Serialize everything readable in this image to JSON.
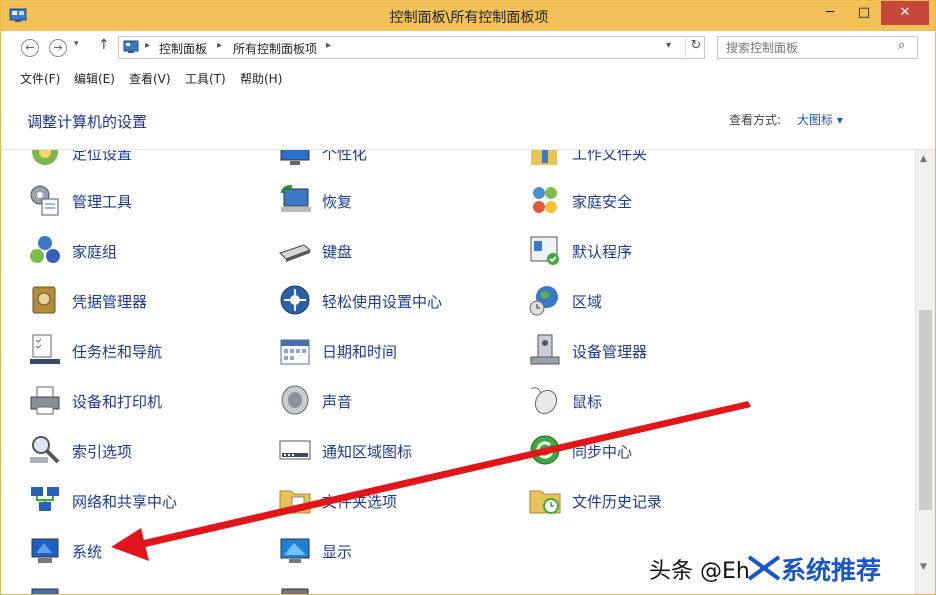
{
  "window": {
    "title": "控制面板\\所有控制面板项",
    "controls": {
      "minimize": "─",
      "maximize": "□",
      "close": "✕"
    }
  },
  "nav": {
    "back": "←",
    "forward": "→",
    "history": "▾",
    "up": "↑",
    "breadcrumbs": [
      "控制面板",
      "所有控制面板项"
    ],
    "crumb_separator": "▸",
    "address_dropdown": "▾",
    "refresh": "↻",
    "search_placeholder": "搜索控制面板",
    "search_icon": "⌕"
  },
  "menu": [
    "文件(F)",
    "编辑(E)",
    "查看(V)",
    "工具(T)",
    "帮助(H)"
  ],
  "header": {
    "title": "调整计算机的设置",
    "view_label": "查看方式:",
    "view_value": "大图标 ▾"
  },
  "items": [
    {
      "label": "定位设置",
      "icon": "location-icon"
    },
    {
      "label": "个性化",
      "icon": "personalize-icon"
    },
    {
      "label": "工作文件夹",
      "icon": "work-folders-icon"
    },
    {
      "label": "管理工具",
      "icon": "admin-tools-icon"
    },
    {
      "label": "恢复",
      "icon": "recovery-icon"
    },
    {
      "label": "家庭安全",
      "icon": "family-safety-icon"
    },
    {
      "label": "家庭组",
      "icon": "homegroup-icon"
    },
    {
      "label": "键盘",
      "icon": "keyboard-icon"
    },
    {
      "label": "默认程序",
      "icon": "default-programs-icon"
    },
    {
      "label": "凭据管理器",
      "icon": "credential-icon"
    },
    {
      "label": "轻松使用设置中心",
      "icon": "ease-of-access-icon"
    },
    {
      "label": "区域",
      "icon": "region-icon"
    },
    {
      "label": "任务栏和导航",
      "icon": "taskbar-icon"
    },
    {
      "label": "日期和时间",
      "icon": "calendar-icon"
    },
    {
      "label": "设备管理器",
      "icon": "device-manager-icon"
    },
    {
      "label": "设备和打印机",
      "icon": "printer-icon"
    },
    {
      "label": "声音",
      "icon": "sound-icon"
    },
    {
      "label": "鼠标",
      "icon": "mouse-icon"
    },
    {
      "label": "索引选项",
      "icon": "indexing-icon"
    },
    {
      "label": "通知区域图标",
      "icon": "notification-icon"
    },
    {
      "label": "同步中心",
      "icon": "sync-icon"
    },
    {
      "label": "网络和共享中心",
      "icon": "network-icon"
    },
    {
      "label": "文件夹选项",
      "icon": "folder-options-icon"
    },
    {
      "label": "文件历史记录",
      "icon": "file-history-icon"
    },
    {
      "label": "系统",
      "icon": "system-icon"
    },
    {
      "label": "显示",
      "icon": "display-icon"
    }
  ],
  "scrollbar": {
    "up": "▲",
    "down": "▼"
  },
  "watermark": {
    "text": "头条 @Eh",
    "brand": "系统推荐"
  },
  "colors": {
    "titlebar": "#f1c157",
    "link": "#1f3a8a",
    "arrow": "#e0161b"
  }
}
